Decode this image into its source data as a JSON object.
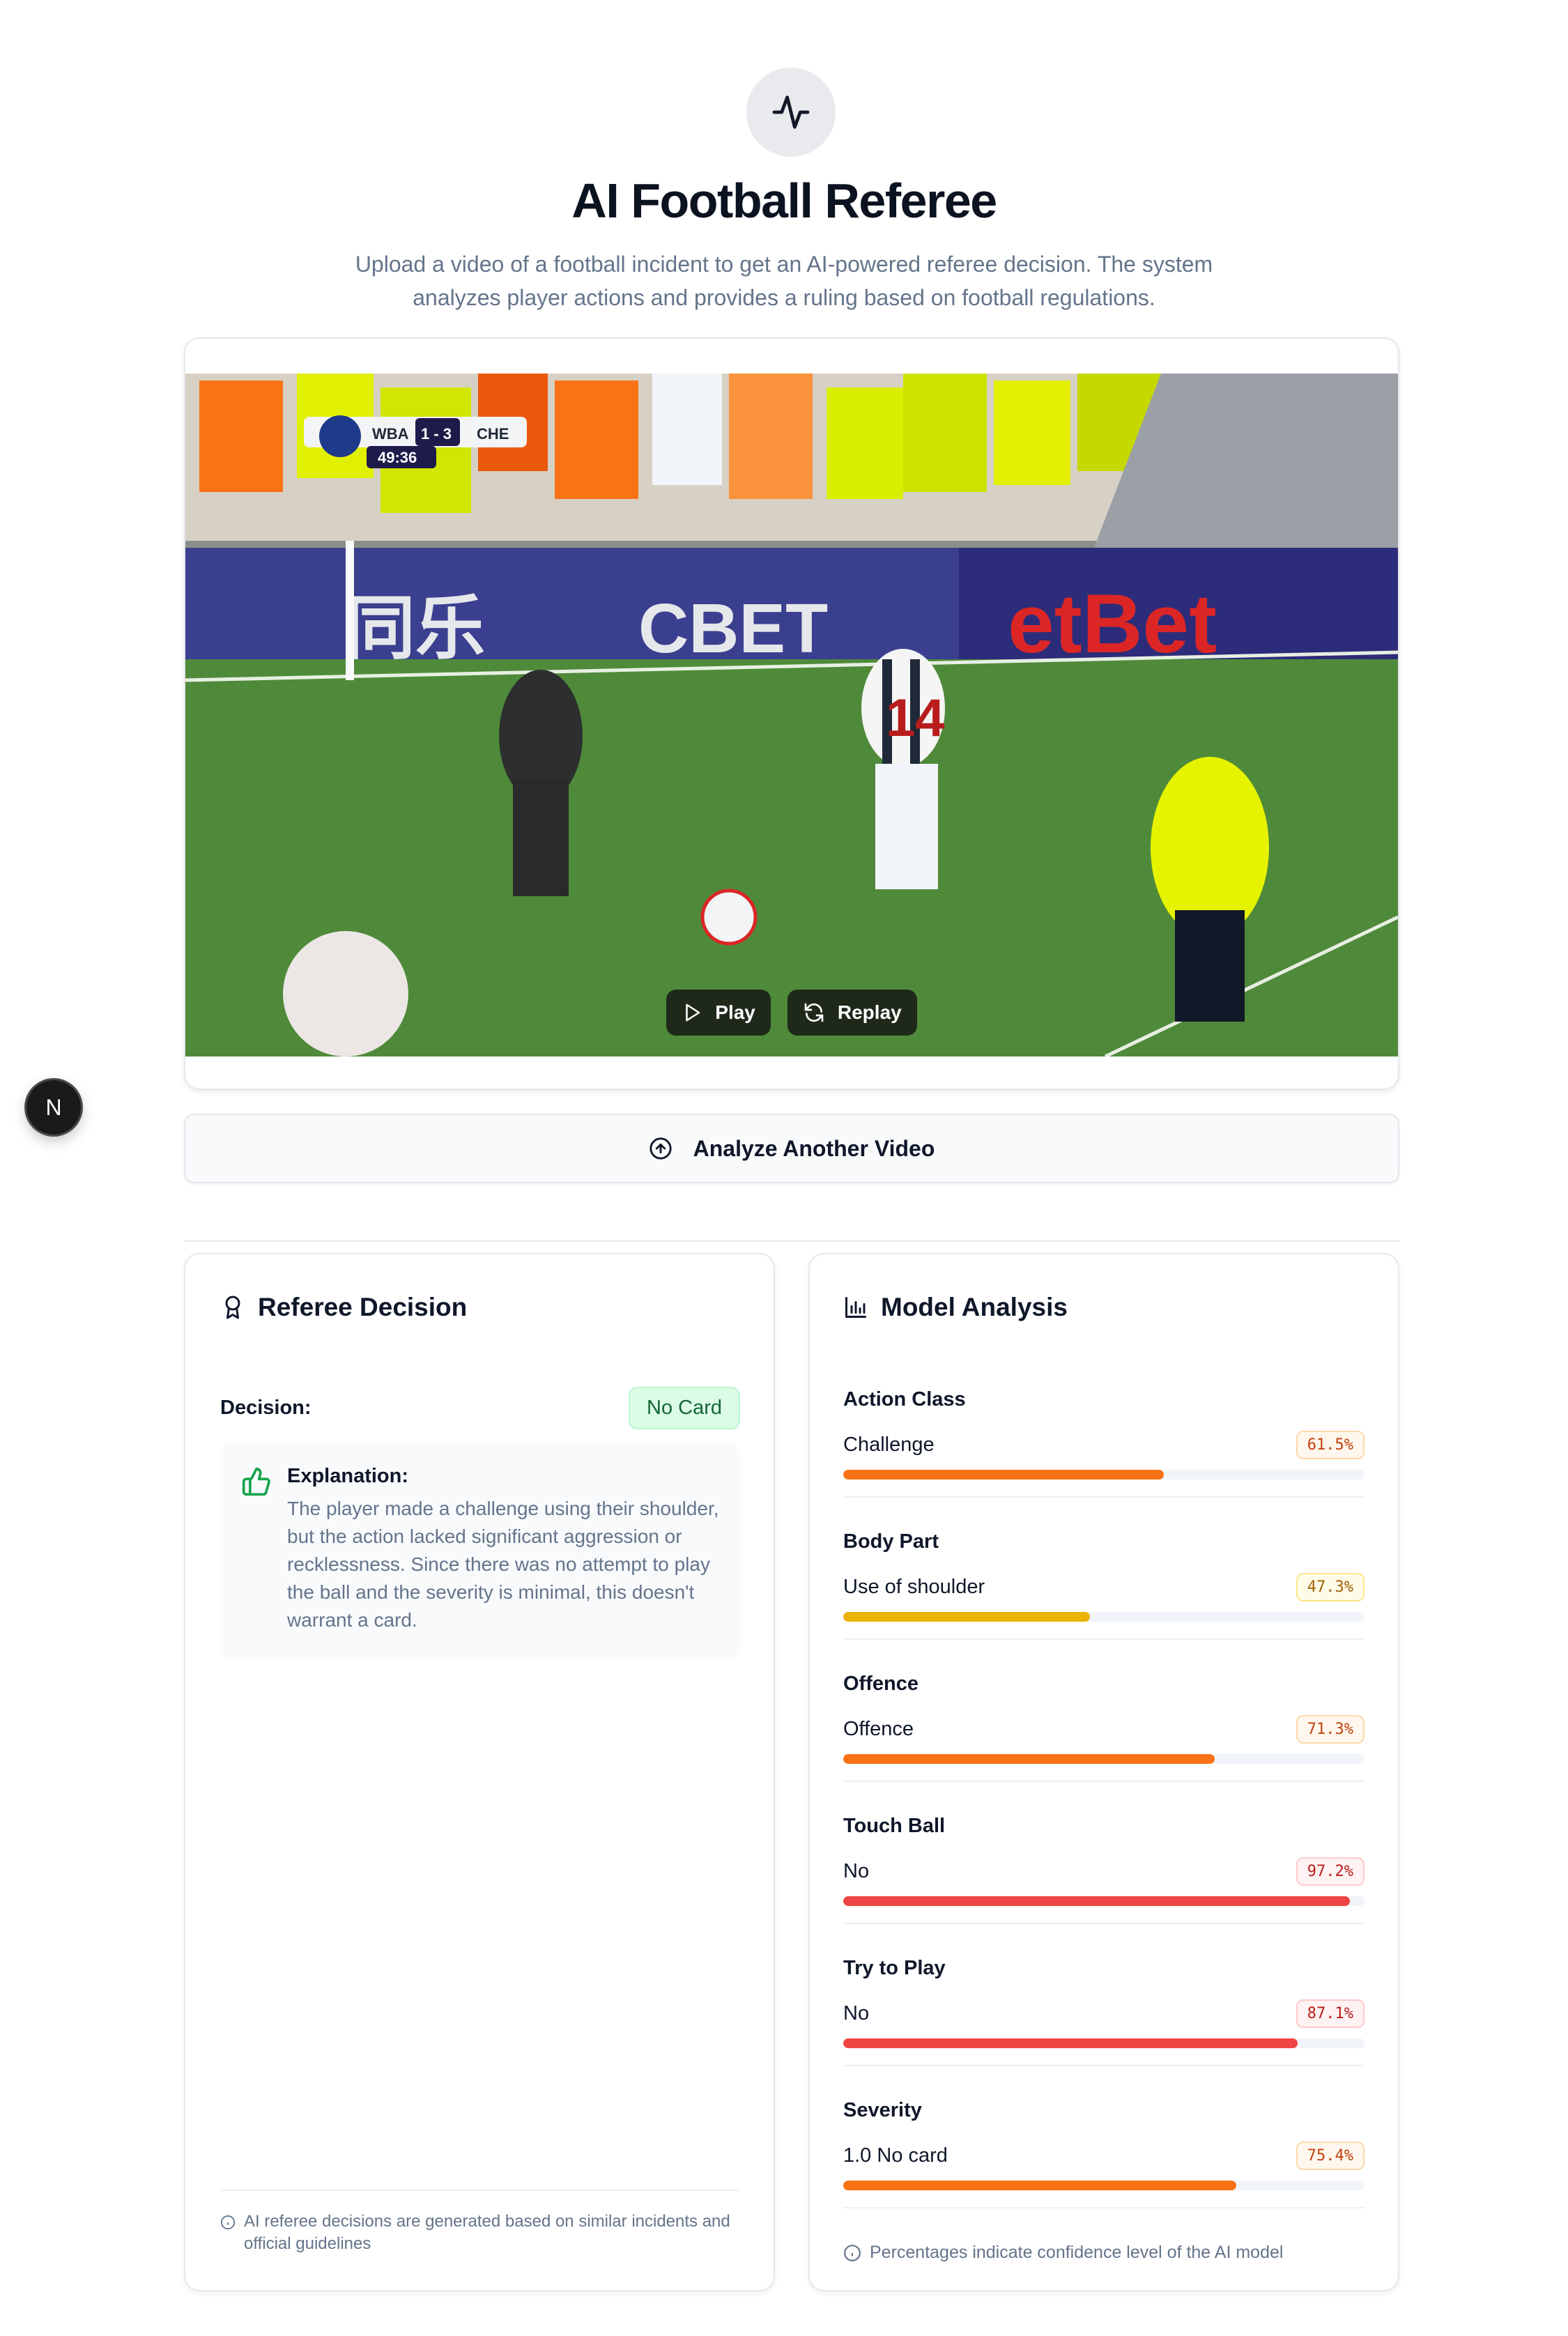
{
  "header": {
    "logo_icon": "activity-pulse-icon",
    "title": "AI Football Referee",
    "subtitle": "Upload a video of a football incident to get an AI-powered referee decision. The system analyzes player actions and provides a ruling based on football regulations."
  },
  "video": {
    "scoreboard": {
      "home": "WBA",
      "score": "1 - 3",
      "away": "CHE",
      "clock": "49:36"
    },
    "ad_boards": [
      "同乐",
      "CBET",
      "etBet"
    ],
    "player_number": "14",
    "play_label": "Play",
    "replay_label": "Replay"
  },
  "floating_badge": {
    "letter": "N"
  },
  "analyze_button": {
    "label": "Analyze Another Video",
    "icon": "upload-circle-icon"
  },
  "referee_decision": {
    "title": "Referee Decision",
    "icon": "award-ribbon-icon",
    "decision_label": "Decision:",
    "decision_value": "No Card",
    "explanation_title": "Explanation:",
    "explanation_icon": "thumbs-up-icon",
    "explanation_text": "The player made a challenge using their shoulder, but the action lacked significant aggression or recklessness. Since there was no attempt to play the ball and the severity is minimal, this doesn't warrant a card.",
    "footer": "AI referee decisions are generated based on similar incidents and official guidelines"
  },
  "model_analysis": {
    "title": "Model Analysis",
    "icon": "bar-chart-icon",
    "metrics": [
      {
        "title": "Action Class",
        "value": "Challenge",
        "pct": "61.5%",
        "fraction": 0.615,
        "color": "#f97316",
        "tone": "orange"
      },
      {
        "title": "Body Part",
        "value": "Use of shoulder",
        "pct": "47.3%",
        "fraction": 0.473,
        "color": "#eab308",
        "tone": "yellow"
      },
      {
        "title": "Offence",
        "value": "Offence",
        "pct": "71.3%",
        "fraction": 0.713,
        "color": "#f97316",
        "tone": "orange"
      },
      {
        "title": "Touch Ball",
        "value": "No",
        "pct": "97.2%",
        "fraction": 0.972,
        "color": "#ef4444",
        "tone": "red"
      },
      {
        "title": "Try to Play",
        "value": "No",
        "pct": "87.1%",
        "fraction": 0.871,
        "color": "#ef4444",
        "tone": "red"
      },
      {
        "title": "Severity",
        "value": "1.0 No card",
        "pct": "75.4%",
        "fraction": 0.754,
        "color": "#f97316",
        "tone": "orange"
      }
    ],
    "footer": "Percentages indicate confidence level of the AI model"
  }
}
